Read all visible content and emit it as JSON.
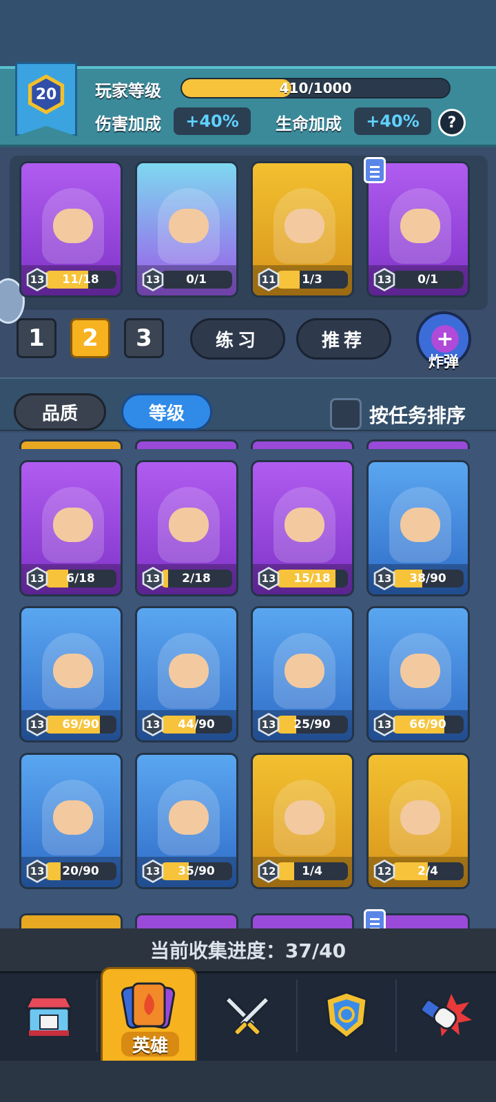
{
  "player": {
    "level": "20",
    "level_label": "玩家等级",
    "xp_text": "410/1000",
    "xp_fraction": 0.41,
    "damage_label": "伤害加成",
    "damage_value": "+40%",
    "health_label": "生命加成",
    "health_value": "+40%",
    "help_symbol": "?"
  },
  "deck": {
    "cards": [
      {
        "name": "orc-hero",
        "rarity": "purple",
        "level": "13",
        "progress_text": "11/18",
        "progress": 0.61
      },
      {
        "name": "panda-hero",
        "rarity": "teal",
        "level": "13",
        "progress_text": "0/1",
        "progress": 0.0
      },
      {
        "name": "chicken-hero",
        "rarity": "gold",
        "level": "11",
        "progress_text": "1/3",
        "progress": 0.33
      },
      {
        "name": "samurai-hero",
        "rarity": "purple",
        "level": "13",
        "progress_text": "0/1",
        "progress": 0.0
      }
    ],
    "tabs": [
      "1",
      "2",
      "3"
    ],
    "active_tab": 1,
    "practice_label": "练习",
    "recommend_label": "推荐",
    "bomb_label": "炸弹",
    "bomb_symbol": "+"
  },
  "sort": {
    "quality_label": "品质",
    "level_label": "等级",
    "by_task_label": "按任务排序"
  },
  "collection": {
    "rows": [
      [
        {
          "name": "tiger-pirate-hero",
          "rarity": "purple",
          "level": "13",
          "progress_text": "6/18",
          "progress": 0.33
        },
        {
          "name": "dryad-hero",
          "rarity": "purple",
          "level": "13",
          "progress_text": "2/18",
          "progress": 0.11
        },
        {
          "name": "ice-queen-hero",
          "rarity": "purple",
          "level": "13",
          "progress_text": "15/18",
          "progress": 0.83
        },
        {
          "name": "viking-hero",
          "rarity": "blue",
          "level": "13",
          "progress_text": "38/90",
          "progress": 0.42
        }
      ],
      [
        {
          "name": "owl-trio-hero",
          "rarity": "blue",
          "level": "13",
          "progress_text": "69/90",
          "progress": 0.77
        },
        {
          "name": "pirate-brute-hero",
          "rarity": "blue",
          "level": "13",
          "progress_text": "44/90",
          "progress": 0.49
        },
        {
          "name": "old-scholar-hero",
          "rarity": "blue",
          "level": "13",
          "progress_text": "25/90",
          "progress": 0.28
        },
        {
          "name": "spartan-hero",
          "rarity": "blue",
          "level": "13",
          "progress_text": "66/90",
          "progress": 0.73
        }
      ],
      [
        {
          "name": "blonde-fighter-hero",
          "rarity": "blue",
          "level": "13",
          "progress_text": "20/90",
          "progress": 0.22
        },
        {
          "name": "caveman-hero",
          "rarity": "blue",
          "level": "13",
          "progress_text": "35/90",
          "progress": 0.39
        },
        {
          "name": "bat-hero",
          "rarity": "gold",
          "level": "12",
          "progress_text": "1/4",
          "progress": 0.25
        },
        {
          "name": "old-wizard-hero",
          "rarity": "gold",
          "level": "12",
          "progress_text": "2/4",
          "progress": 0.5
        }
      ]
    ],
    "progress_label": "当前收集进度：37/40"
  },
  "nav": {
    "items": [
      {
        "name": "shop",
        "icon": "shop-icon"
      },
      {
        "name": "heroes",
        "icon": "hero-cards-icon",
        "label": "英雄"
      },
      {
        "name": "battle",
        "icon": "crossed-swords-icon"
      },
      {
        "name": "clan",
        "icon": "crest-icon"
      },
      {
        "name": "events",
        "icon": "punch-icon"
      }
    ]
  },
  "colors": {
    "accent_gold": "#f6b21f",
    "bonus_text": "#5fd2ff",
    "active_blue": "#2f8ae8"
  }
}
